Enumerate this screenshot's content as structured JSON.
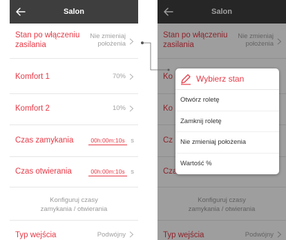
{
  "header": {
    "title": "Salon"
  },
  "rows": {
    "stan": {
      "label_line1": "Stan po włączeniu",
      "label_line2": "zasilania",
      "value_line1": "Nie zmieniaj",
      "value_line2": "położenia"
    },
    "komfort1": {
      "label": "Komfort 1",
      "value": "70%"
    },
    "komfort2": {
      "label": "Komfort 2",
      "value": "10%"
    },
    "czas_zamykania": {
      "label": "Czas zamykania",
      "value": "00h:00m:10s",
      "unit": "s"
    },
    "czas_otwierania": {
      "label": "Czas otwierania",
      "value": "00h:00m:10s",
      "unit": "s"
    },
    "konfiguruj": {
      "line1": "Konfiguruj czasy",
      "line2": "zamykania / otwierania"
    },
    "typ_wejscia": {
      "label": "Typ wejścia",
      "value": "Podwójny"
    }
  },
  "right_partial": {
    "stan_value_line1": "Nie zmieniaj",
    "stan_value_line2": "położenia",
    "komfort1_prefix": "Ko",
    "komfort2_prefix": "Ko",
    "czas_zam_prefix": "Cz",
    "czas_otw_prefix": "Czas otwierania"
  },
  "popup": {
    "title": "Wybierz stan",
    "options": [
      "Otwórz roletę",
      "Zamknij roletę",
      "Nie zmieniaj położenia",
      "Wartość %"
    ]
  },
  "colors": {
    "accent": "#e63946",
    "header_bg": "#3e3e3e",
    "muted": "#a0a0a0"
  },
  "icons": {
    "back": "arrow-left-icon",
    "chevron": "chevron-right-icon",
    "pencil": "pencil-icon"
  }
}
